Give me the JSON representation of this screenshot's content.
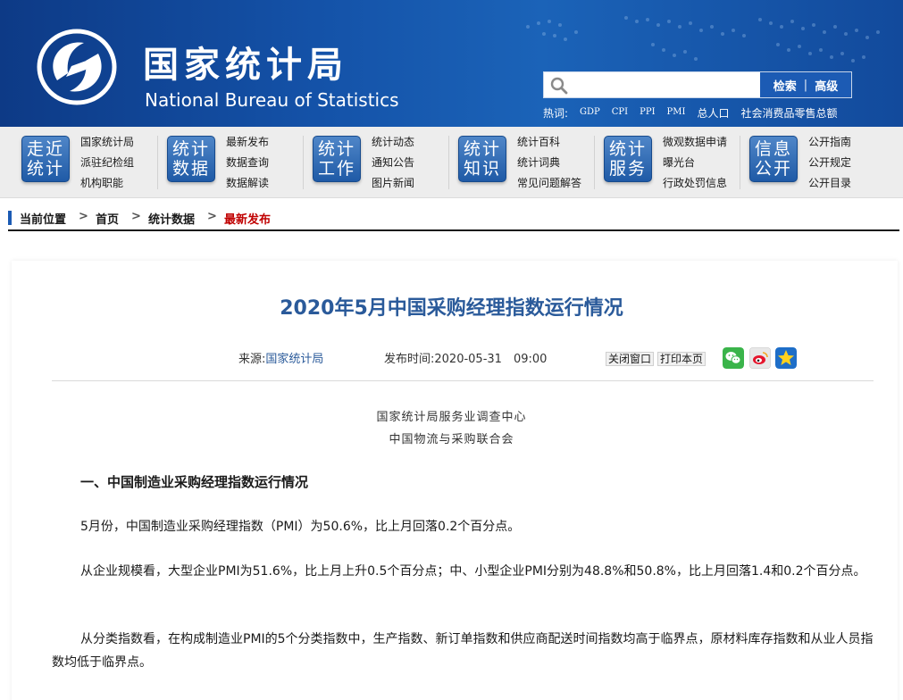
{
  "header": {
    "logo_cn": "国家统计局",
    "logo_en": "National Bureau of Statistics",
    "search": {
      "placeholder": "",
      "search_label": "检索",
      "separator": "|",
      "advanced_label": "高级"
    },
    "hot_label": "热词:",
    "hot_words": [
      "GDP",
      "CPI",
      "PPI",
      "PMI",
      "总人口",
      "社会消费品零售总额"
    ],
    "colors": {
      "brand_blue": "#1452a8",
      "button_blue": "#1c5bb4"
    }
  },
  "nav": {
    "groups": [
      {
        "badge": [
          "走近",
          "统计"
        ],
        "links": [
          "国家统计局",
          "派驻纪检组",
          "机构职能"
        ]
      },
      {
        "badge": [
          "统计",
          "数据"
        ],
        "links": [
          "最新发布",
          "数据查询",
          "数据解读"
        ]
      },
      {
        "badge": [
          "统计",
          "工作"
        ],
        "links": [
          "统计动态",
          "通知公告",
          "图片新闻"
        ]
      },
      {
        "badge": [
          "统计",
          "知识"
        ],
        "links": [
          "统计百科",
          "统计词典",
          "常见问题解答"
        ]
      },
      {
        "badge": [
          "统计",
          "服务"
        ],
        "links": [
          "微观数据申请",
          "曝光台",
          "行政处罚信息"
        ]
      },
      {
        "badge": [
          "信息",
          "公开"
        ],
        "links": [
          "公开指南",
          "公开规定",
          "公开目录"
        ]
      }
    ]
  },
  "breadcrumb": {
    "label": "当前位置",
    "sep": ">",
    "items": [
      "首页",
      "统计数据",
      "最新发布"
    ]
  },
  "article": {
    "title": "2020年5月中国采购经理指数运行情况",
    "source_label": "来源:",
    "source": "国家统计局",
    "time_label": "发布时间:",
    "time": "2020-05-31　09:00",
    "close_label": "关闭窗口",
    "print_label": "打印本页",
    "org_lines": [
      "国家统计局服务业调查中心",
      "中国物流与采购联合会"
    ],
    "section1": "一、中国制造业采购经理指数运行情况",
    "paragraphs": [
      "5月份，中国制造业采购经理指数（PMI）为50.6%，比上月回落0.2个百分点。",
      "从企业规模看，大型企业PMI为51.6%，比上月上升0.5个百分点；中、小型企业PMI分别为48.8%和50.8%，比上月回落1.4和0.2个百分点。",
      "从分类指数看，在构成制造业PMI的5个分类指数中，生产指数、新订单指数和供应商配送时间指数均高于临界点，原材料库存指数和从业人员指数均低于临界点。"
    ],
    "share_icons": [
      "wechat-icon",
      "weibo-icon",
      "qzone-icon"
    ],
    "colors": {
      "title": "#2a5a9a",
      "current_crumb": "#c00000"
    }
  }
}
